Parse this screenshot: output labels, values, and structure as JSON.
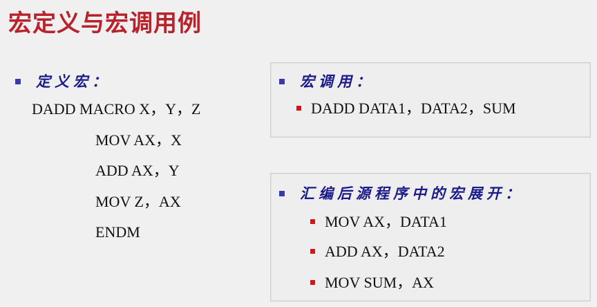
{
  "title": "宏定义与宏调用例",
  "definition": {
    "heading": "定义宏：",
    "lines": [
      "DADD MACRO X，Y，Z",
      "MOV AX，X",
      "ADD AX，Y",
      "MOV Z，AX",
      "ENDM"
    ]
  },
  "call": {
    "heading": "宏调用：",
    "items": [
      "DADD DATA1，DATA2，SUM"
    ]
  },
  "expansion": {
    "heading": "汇编后源程序中的宏展开：",
    "items": [
      "MOV AX，DATA1",
      "ADD AX，DATA2",
      "MOV SUM，AX"
    ]
  },
  "colors": {
    "title": "#b8232b",
    "heading": "#1a1a8a",
    "heading_bullet": "#3a3aa8",
    "item_bullet": "#e01010"
  }
}
